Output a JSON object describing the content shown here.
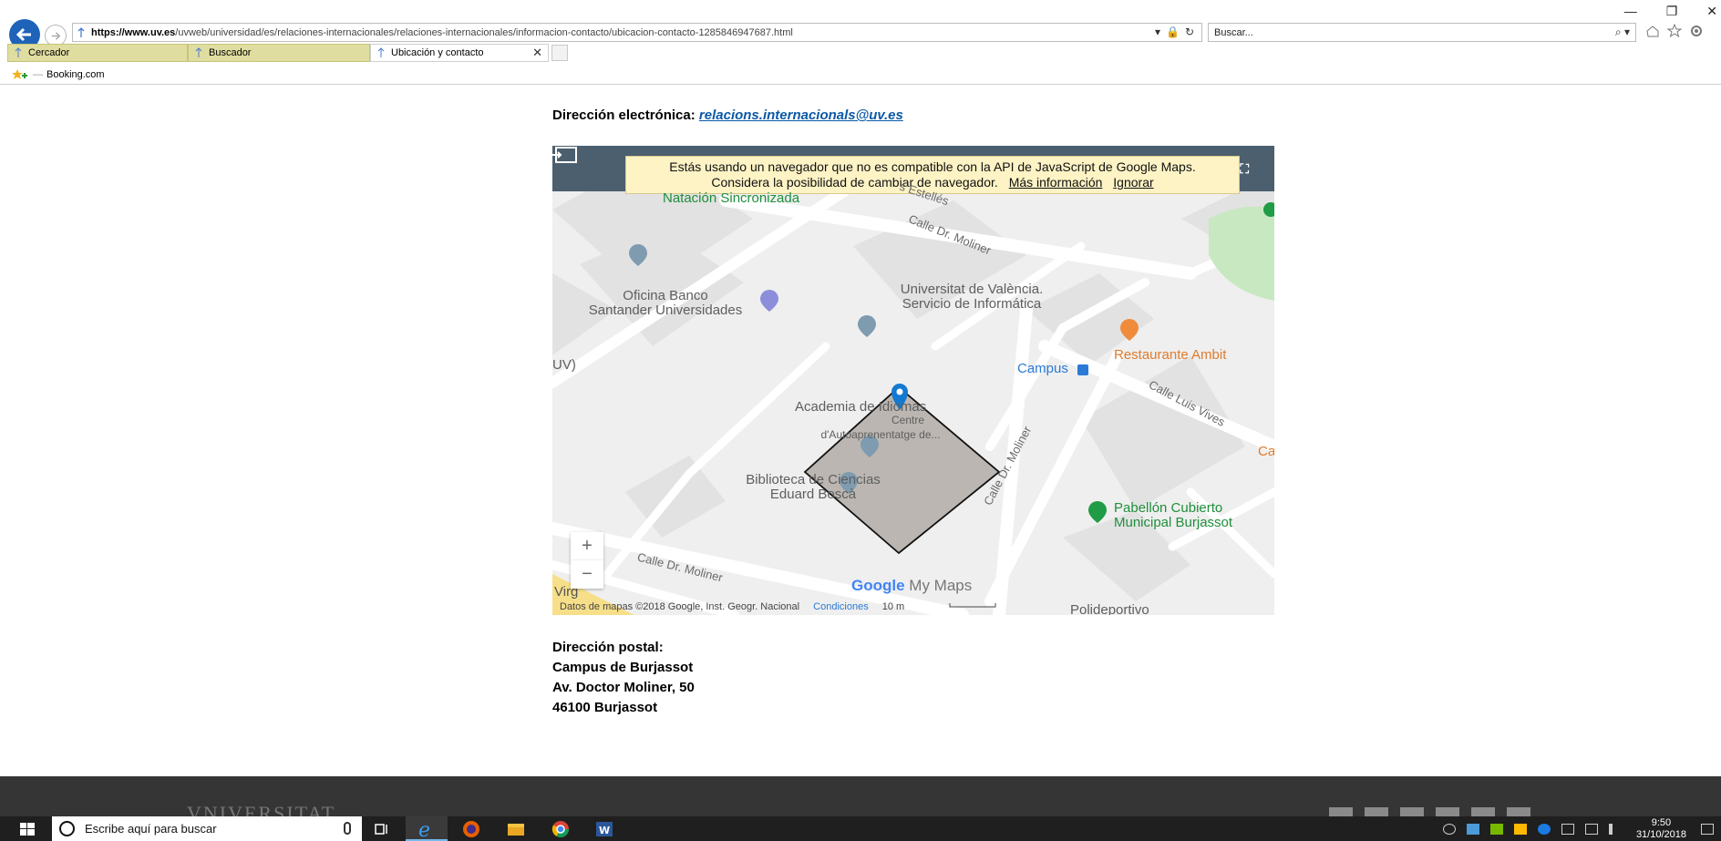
{
  "browser": {
    "url_domain": "https://www.uv.es",
    "url_rest": "/uvweb/universidad/es/relaciones-internacionales/relaciones-internacionales/informacion-contacto/ubicacion-contacto-1285846947687.html",
    "search_placeholder": "Buscar...",
    "tabs": [
      {
        "label": "Cercador"
      },
      {
        "label": "Buscador"
      },
      {
        "label": "Ubicación y contacto",
        "active": true
      }
    ],
    "favorites": [
      {
        "label": "Booking.com"
      }
    ]
  },
  "contact": {
    "email_label": "Dirección electrónica:",
    "email": "relacions.internacionals@uv.es",
    "postal_label": "Dirección postal:",
    "postal_lines": [
      "Campus de Burjassot",
      "Av. Doctor Moliner, 50",
      "46100 Burjassot"
    ]
  },
  "map": {
    "warning_line1": "Estás usando un navegador que no es compatible con la API de JavaScript de Google Maps.",
    "warning_line2": "Considera la posibilidad de cambiar de navegador.",
    "more_info": "Más información",
    "ignore": "Ignorar",
    "labels": {
      "natacion": "Natación Sincronizada",
      "oficina_banco_1": "Oficina Banco",
      "oficina_banco_2": "Santander Universidades",
      "uv_serv_1": "Universitat de València.",
      "uv_serv_2": "Servicio de Informática",
      "campus": "Campus",
      "restaurante": "Restaurante Ambit",
      "academia": "Academia de Idiomas",
      "centre_1": "Centre",
      "centre_2": "d'Autoaprenentatge de...",
      "biblioteca_1": "Biblioteca de Ciencias",
      "biblioteca_2": "Eduard Boscà",
      "pabellon_1": "Pabellón Cubierto",
      "pabellon_2": "Municipal Burjassot",
      "polideportivo": "Polideportivo",
      "uv_left": "UV)",
      "ca": "Ca",
      "virg": "Virg"
    },
    "roads": {
      "estelles": "s Estellés",
      "moliner_top": "Calle Dr. Moliner",
      "luis_vives": "Calle Luis Vives",
      "moliner_vertical": "Calle Dr. Moliner",
      "moliner_bottom": "Calle Dr. Moliner"
    },
    "zoom_in": "+",
    "zoom_out": "−",
    "attribution": "Datos de mapas ©2018 Google, Inst. Geogr. Nacional",
    "conditions": "Condiciones",
    "scale": "10 m",
    "logo_google": "Google",
    "logo_mymaps": "My Maps"
  },
  "footer": {
    "brand": "VNIVERSITAT"
  },
  "taskbar": {
    "search_placeholder": "Escribe aquí para buscar",
    "time": "9:50",
    "date": "31/10/2018"
  },
  "colors": {
    "accent": "#1e63b8",
    "map_topbar": "#4b5f6e",
    "polygon": "#b2aba6",
    "warning_bg": "#fdf3c5"
  }
}
